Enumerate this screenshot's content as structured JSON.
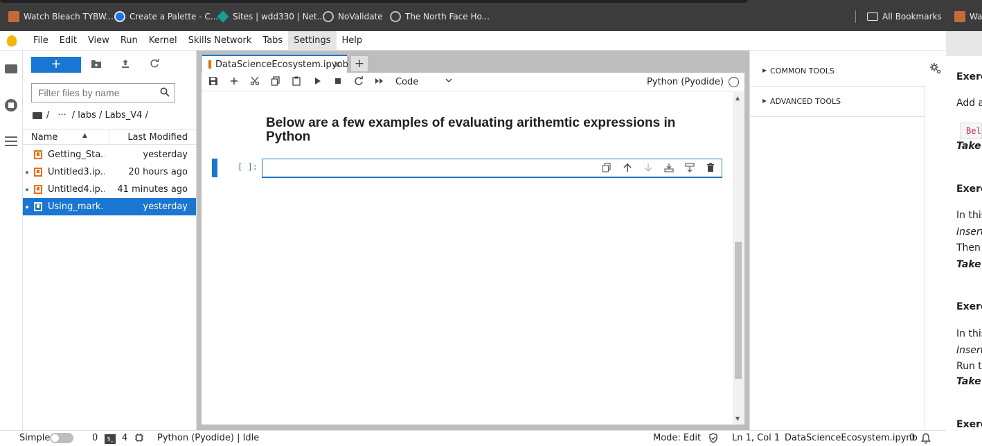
{
  "bookmarks": {
    "items": [
      {
        "label": "Watch Bleach TYBW...",
        "icon": "anime-icon"
      },
      {
        "label": "Create a Palette - C...",
        "icon": "coolors-icon"
      },
      {
        "label": "Sites | wdd330 | Net...",
        "icon": "netlify-icon"
      },
      {
        "label": "NoValidate",
        "icon": "globe-icon"
      },
      {
        "label": "The North Face Ho...",
        "icon": "globe-icon"
      }
    ],
    "all_bookmarks": "All Bookmarks",
    "overflow_label": "Wa"
  },
  "menubar": {
    "items": [
      "File",
      "Edit",
      "View",
      "Run",
      "Kernel",
      "Skills Network",
      "Tabs",
      "Settings",
      "Help"
    ],
    "active": "Settings"
  },
  "filebrowser": {
    "new_button": "+",
    "filter_placeholder": "Filter files by name",
    "breadcrumbs": {
      "sep1": "/",
      "ellipsis": "···",
      "path": "/ labs / Labs_V4 /"
    },
    "columns": {
      "name": "Name",
      "modified": "Last Modified"
    },
    "files": [
      {
        "name": "Getting_Sta...",
        "modified": "yesterday",
        "running": false,
        "selected": false
      },
      {
        "name": "Untitled3.ip...",
        "modified": "20 hours ago",
        "running": true,
        "selected": false
      },
      {
        "name": "Untitled4.ip...",
        "modified": "41 minutes ago",
        "running": true,
        "selected": false
      },
      {
        "name": "Using_mark...",
        "modified": "yesterday",
        "running": true,
        "selected": true
      }
    ]
  },
  "notebook": {
    "tab_title": "DataScienceEcosystem.ipynb",
    "tab_add": "+",
    "cell_type": "Code",
    "kernel": "Python (Pyodide)",
    "markdown_heading": "Below are a few examples of evaluating arithemtic expressions in Python",
    "prompt": "[ ]:"
  },
  "rightpanel": {
    "sections": [
      "COMMON TOOLS",
      "ADVANCED TOOLS"
    ]
  },
  "docstrip": {
    "lines": [
      {
        "text": "Exerc",
        "style": "bold"
      },
      {
        "text": "Add a",
        "style": "normal"
      },
      {
        "text": "Bel",
        "style": "code"
      },
      {
        "text": "Take",
        "style": "bi"
      },
      {
        "text": "Exerc",
        "style": "bold"
      },
      {
        "text": "In this",
        "style": "normal"
      },
      {
        "text": "Insert",
        "style": "ital"
      },
      {
        "text": "Then",
        "style": "normal"
      },
      {
        "text": "Take",
        "style": "bi"
      },
      {
        "text": "Exerc",
        "style": "bold"
      },
      {
        "text": "In this",
        "style": "normal"
      },
      {
        "text": "Insert",
        "style": "ital"
      },
      {
        "text": "Run t",
        "style": "normal"
      },
      {
        "text": "Take",
        "style": "bi"
      },
      {
        "text": "Exerc",
        "style": "bold"
      }
    ]
  },
  "statusbar": {
    "simple": "Simple",
    "count1": "0",
    "terminal_label": "$_",
    "count2": "4",
    "kernel_status": "Python (Pyodide) | Idle",
    "mode": "Mode: Edit",
    "cursor": "Ln 1, Col 1",
    "filename": "DataScienceEcosystem.ipynb",
    "notifications": "0"
  },
  "colors": {
    "accent": "#1976d2",
    "notebook_icon": "#ef6c00",
    "running_dot": "#388e3c"
  }
}
